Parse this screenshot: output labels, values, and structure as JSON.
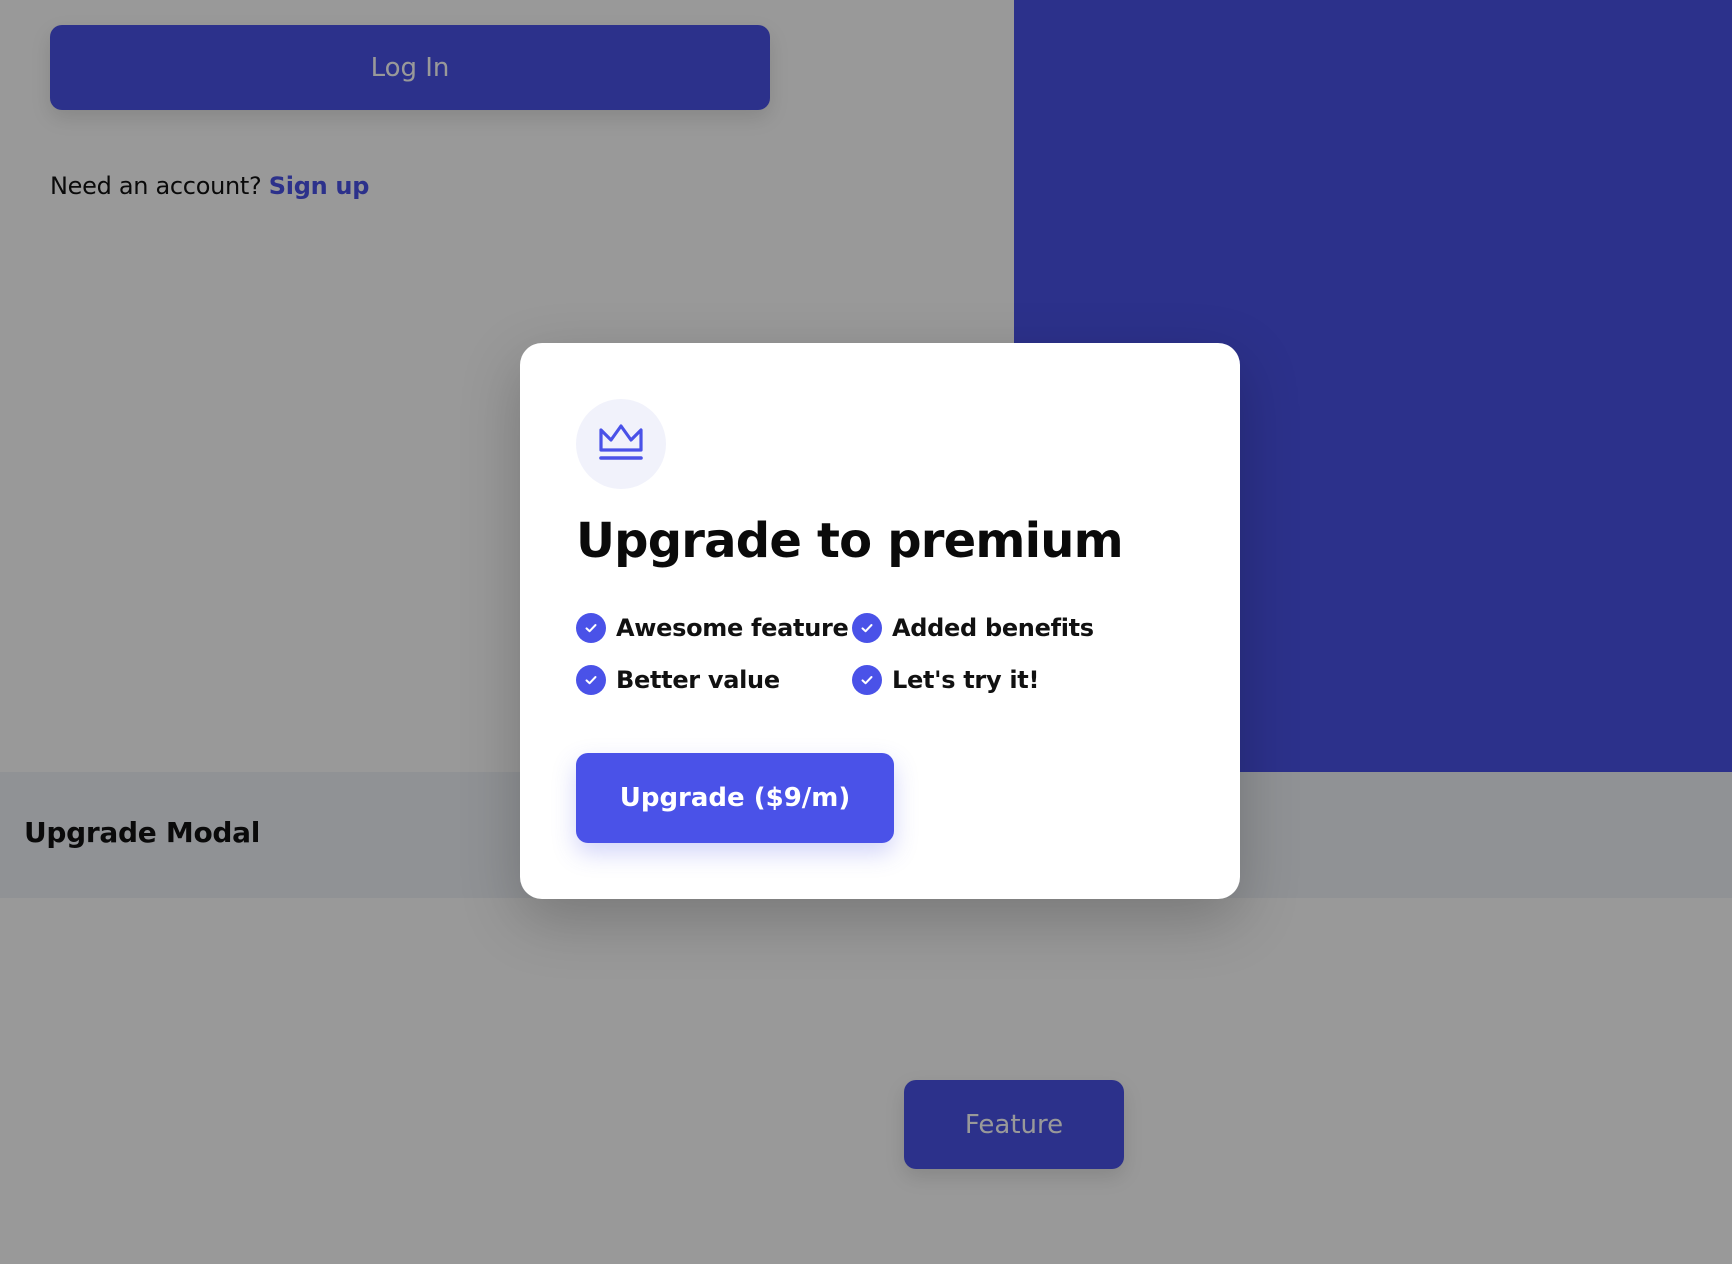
{
  "background": {
    "login_button_label": "Log In",
    "signup_prompt": "Need an account?",
    "signup_link": "Sign up",
    "section_title": "Upgrade Modal",
    "feature_button_label": "Feature"
  },
  "modal": {
    "icon": "crown-icon",
    "title": "Upgrade to premium",
    "features": [
      {
        "label": "Awesome feature",
        "icon": "check-circle-icon"
      },
      {
        "label": "Added benefits",
        "icon": "check-circle-icon"
      },
      {
        "label": "Better value",
        "icon": "check-circle-icon"
      },
      {
        "label": "Let's try it!",
        "icon": "check-circle-icon"
      }
    ],
    "cta_label": "Upgrade ($9/m)"
  },
  "colors": {
    "accent": "#4a52e8",
    "overlay": "rgba(0,0,0,0.40)",
    "icon_bg": "#f1f2fb"
  }
}
